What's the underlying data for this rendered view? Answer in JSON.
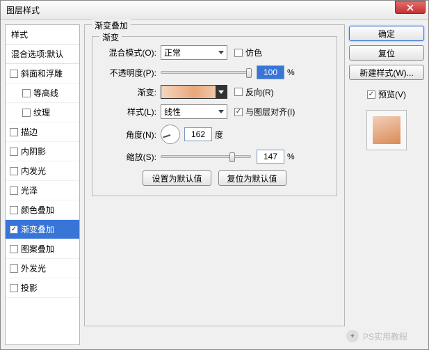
{
  "window": {
    "title": "图层样式"
  },
  "sidebar": {
    "head": "样式",
    "blend_defaults": "混合选项:默认",
    "items": [
      {
        "label": "斜面和浮雕",
        "checked": false,
        "indent": false
      },
      {
        "label": "等高线",
        "checked": false,
        "indent": true
      },
      {
        "label": "纹理",
        "checked": false,
        "indent": true
      },
      {
        "label": "描边",
        "checked": false,
        "indent": false
      },
      {
        "label": "内阴影",
        "checked": false,
        "indent": false
      },
      {
        "label": "内发光",
        "checked": false,
        "indent": false
      },
      {
        "label": "光泽",
        "checked": false,
        "indent": false
      },
      {
        "label": "颜色叠加",
        "checked": false,
        "indent": false
      },
      {
        "label": "渐变叠加",
        "checked": true,
        "indent": false,
        "selected": true
      },
      {
        "label": "图案叠加",
        "checked": false,
        "indent": false
      },
      {
        "label": "外发光",
        "checked": false,
        "indent": false
      },
      {
        "label": "投影",
        "checked": false,
        "indent": false
      }
    ]
  },
  "panel": {
    "outer_legend": "渐变叠加",
    "inner_legend": "渐变",
    "blend_mode": {
      "label": "混合模式(O):",
      "value": "正常"
    },
    "dither": {
      "label": "仿色",
      "checked": false
    },
    "opacity": {
      "label": "不透明度(P):",
      "value": "100",
      "unit": "%"
    },
    "gradient": {
      "label": "渐变:"
    },
    "reverse": {
      "label": "反向(R)",
      "checked": false
    },
    "style": {
      "label": "样式(L):",
      "value": "线性"
    },
    "align": {
      "label": "与图层对齐(I)",
      "checked": true
    },
    "angle": {
      "label": "角度(N):",
      "value": "162",
      "unit": "度"
    },
    "scale": {
      "label": "缩放(S):",
      "value": "147",
      "unit": "%"
    },
    "make_default": "设置为默认值",
    "reset_default": "复位为默认值"
  },
  "right": {
    "ok": "确定",
    "reset": "复位",
    "new_style": "新建样式(W)...",
    "preview": {
      "label": "预览(V)",
      "checked": true
    }
  },
  "watermark": "PS实用教程"
}
